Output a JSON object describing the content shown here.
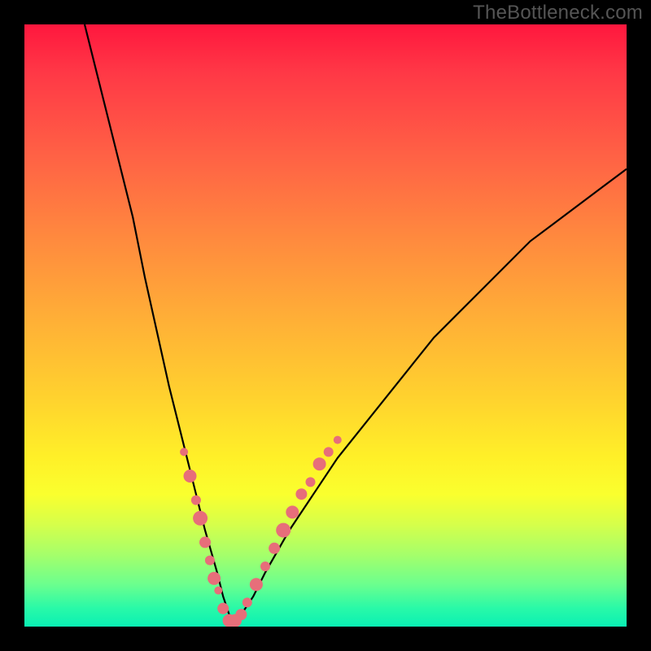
{
  "watermark": "TheBottleneck.com",
  "chart_data": {
    "type": "line",
    "title": "",
    "xlabel": "",
    "ylabel": "",
    "xlim": [
      0,
      100
    ],
    "ylim": [
      0,
      100
    ],
    "series": [
      {
        "name": "bottleneck-curve",
        "x": [
          10,
          12,
          15,
          18,
          20,
          22,
          24,
          26,
          28,
          30,
          32,
          33,
          34,
          35,
          36,
          38,
          40,
          44,
          48,
          52,
          56,
          60,
          64,
          68,
          72,
          76,
          80,
          84,
          88,
          92,
          96,
          100
        ],
        "y": [
          100,
          92,
          80,
          68,
          58,
          49,
          40,
          32,
          24,
          16,
          9,
          5,
          2,
          1,
          2,
          5,
          9,
          16,
          22,
          28,
          33,
          38,
          43,
          48,
          52,
          56,
          60,
          64,
          67,
          70,
          73,
          76
        ],
        "color": "#000000"
      }
    ],
    "markers": [
      {
        "name": "bottleneck-markers",
        "color": "#e76e7a",
        "points": [
          {
            "x": 26.5,
            "y": 29,
            "r": 5
          },
          {
            "x": 27.5,
            "y": 25,
            "r": 8
          },
          {
            "x": 28.5,
            "y": 21,
            "r": 6
          },
          {
            "x": 29.2,
            "y": 18,
            "r": 9
          },
          {
            "x": 30.0,
            "y": 14,
            "r": 7
          },
          {
            "x": 30.8,
            "y": 11,
            "r": 6
          },
          {
            "x": 31.5,
            "y": 8,
            "r": 8
          },
          {
            "x": 32.2,
            "y": 6,
            "r": 5
          },
          {
            "x": 33.0,
            "y": 3,
            "r": 7
          },
          {
            "x": 34.0,
            "y": 1,
            "r": 8
          },
          {
            "x": 35.0,
            "y": 1,
            "r": 8
          },
          {
            "x": 36.0,
            "y": 2,
            "r": 7
          },
          {
            "x": 37.0,
            "y": 4,
            "r": 6
          },
          {
            "x": 38.5,
            "y": 7,
            "r": 8
          },
          {
            "x": 40.0,
            "y": 10,
            "r": 6
          },
          {
            "x": 41.5,
            "y": 13,
            "r": 7
          },
          {
            "x": 43.0,
            "y": 16,
            "r": 9
          },
          {
            "x": 44.5,
            "y": 19,
            "r": 8
          },
          {
            "x": 46.0,
            "y": 22,
            "r": 7
          },
          {
            "x": 47.5,
            "y": 24,
            "r": 6
          },
          {
            "x": 49.0,
            "y": 27,
            "r": 8
          },
          {
            "x": 50.5,
            "y": 29,
            "r": 6
          },
          {
            "x": 52.0,
            "y": 31,
            "r": 5
          }
        ]
      }
    ]
  }
}
